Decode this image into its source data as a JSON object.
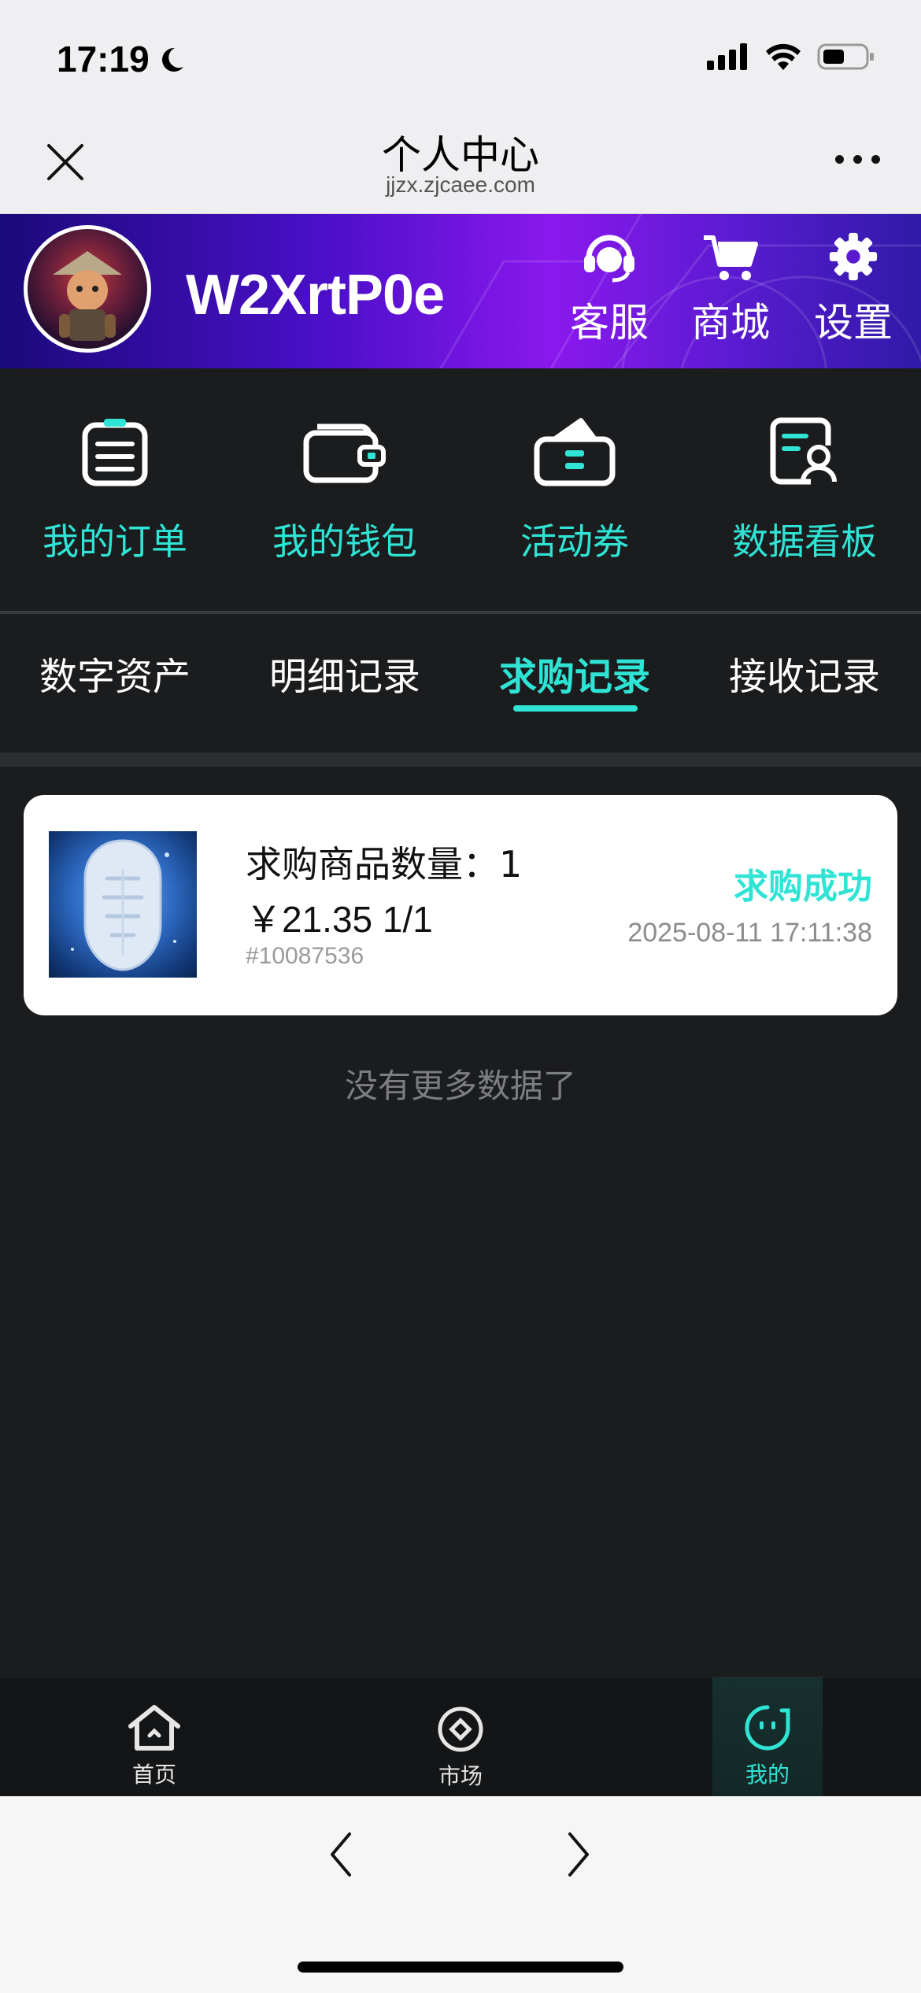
{
  "status_bar": {
    "time": "17:19"
  },
  "navbar": {
    "title": "个人中心",
    "url": "jjzx.zjcaee.com"
  },
  "profile": {
    "username": "W2XrtP0e",
    "actions": [
      {
        "label": "客服",
        "icon": "headset-icon"
      },
      {
        "label": "商城",
        "icon": "cart-icon"
      },
      {
        "label": "设置",
        "icon": "gear-icon"
      }
    ]
  },
  "quick_menu": [
    {
      "label": "我的订单",
      "icon": "clipboard-icon"
    },
    {
      "label": "我的钱包",
      "icon": "wallet-icon"
    },
    {
      "label": "活动券",
      "icon": "coupon-icon"
    },
    {
      "label": "数据看板",
      "icon": "data-board-icon"
    }
  ],
  "tabs": [
    {
      "label": "数字资产",
      "active": false
    },
    {
      "label": "明细记录",
      "active": false
    },
    {
      "label": "求购记录",
      "active": true
    },
    {
      "label": "接收记录",
      "active": false
    }
  ],
  "records": [
    {
      "quantity_text": "求购商品数量：1",
      "price_text": "￥21.35 1/1",
      "code": "#10087536",
      "status": "求购成功",
      "time": "2025-08-11 17:11:38"
    }
  ],
  "list_end_text": "没有更多数据了",
  "bottom_nav": [
    {
      "label": "首页",
      "icon": "home-icon",
      "active": false
    },
    {
      "label": "市场",
      "icon": "market-icon",
      "active": false
    },
    {
      "label": "我的",
      "icon": "profile-face-icon",
      "active": true
    }
  ],
  "colors": {
    "accent": "#2fe4d4",
    "background": "#1b1c1e",
    "banner_purple": "#8a18ee"
  }
}
